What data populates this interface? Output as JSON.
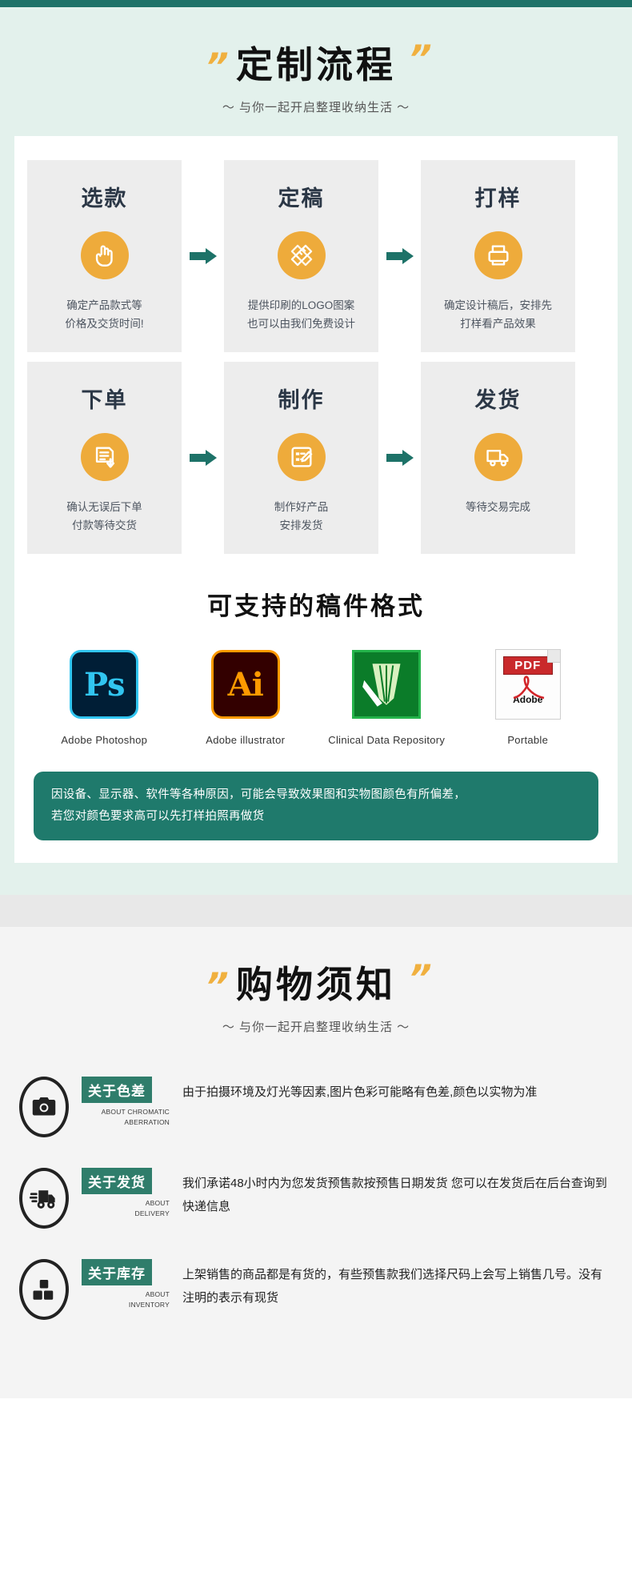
{
  "colors": {
    "topbar": "#1e7268",
    "mint_bg": "#e3f1ec",
    "accent_orange": "#eeab3b",
    "accent_teal": "#1d7268",
    "card_gray": "#ededed",
    "notice_green": "#1f7a6c",
    "tag_green": "#2f7d6b"
  },
  "section_custom": {
    "quote_left": "”",
    "quote_right": "”",
    "title": "定制流程",
    "subtitle": "～ 与你一起开启整理收纳生活 ～",
    "steps": [
      {
        "name": "选款",
        "icon": "hand-pointer-icon",
        "desc_line1": "确定产品款式等",
        "desc_line2": "价格及交货时间!"
      },
      {
        "name": "定稿",
        "icon": "pencil-ruler-icon",
        "desc_line1": "提供印刷的LOGO图案",
        "desc_line2": "也可以由我们免费设计"
      },
      {
        "name": "打样",
        "icon": "printer-sample-icon",
        "desc_line1": "确定设计稿后，安排先",
        "desc_line2": "打样看产品效果"
      },
      {
        "name": "下单",
        "icon": "order-download-icon",
        "desc_line1": "确认无误后下单",
        "desc_line2": "付款等待交货"
      },
      {
        "name": "制作",
        "icon": "edit-board-icon",
        "desc_line1": "制作好产品",
        "desc_line2": "安排发货"
      },
      {
        "name": "发货",
        "icon": "truck-icon",
        "desc_line1": "等待交易完成",
        "desc_line2": ""
      }
    ],
    "arrow_icon": "arrow-right-icon"
  },
  "section_formats": {
    "title": "可支持的稿件格式",
    "items": [
      {
        "icon": "photoshop-icon",
        "glyph": "Ps",
        "label": "Adobe Photoshop"
      },
      {
        "icon": "illustrator-icon",
        "glyph": "Ai",
        "label": "Adobe illustrator"
      },
      {
        "icon": "coreldraw-icon",
        "glyph": "",
        "label": "Clinical  Data  Repository"
      },
      {
        "icon": "pdf-icon",
        "glyph": "PDF",
        "badge": "PDF",
        "adobe": "Adobe",
        "label": "Portable"
      }
    ]
  },
  "notice": {
    "line1": "因设备、显示器、软件等各种原因，可能会导致效果图和实物图颜色有所偏差，",
    "line2": "若您对颜色要求高可以先打样拍照再做货"
  },
  "section_notes": {
    "quote_left": "”",
    "quote_right": "”",
    "title": "购物须知",
    "subtitle": "～ 与你一起开启整理收纳生活 ～",
    "items": [
      {
        "icon": "camera-icon",
        "tag": "关于色差",
        "en_line1": "ABOUT CHROMATIC",
        "en_line2": "ABERRATION",
        "body": "由于拍摄环境及灯光等因素,图片色彩可能略有色差,颜色以实物为准"
      },
      {
        "icon": "delivery-truck-icon",
        "tag": "关于发货",
        "en_line1": "ABOUT",
        "en_line2": "DELIVERY",
        "body": "我们承诺48小时内为您发货预售款按预售日期发货 您可以在发货后在后台查询到快递信息"
      },
      {
        "icon": "inventory-boxes-icon",
        "tag": "关于库存",
        "en_line1": "ABOUT",
        "en_line2": "INVENTORY",
        "body": "上架销售的商品都是有货的，有些预售款我们选择尺码上会写上销售几号。没有注明的表示有现货"
      }
    ]
  }
}
